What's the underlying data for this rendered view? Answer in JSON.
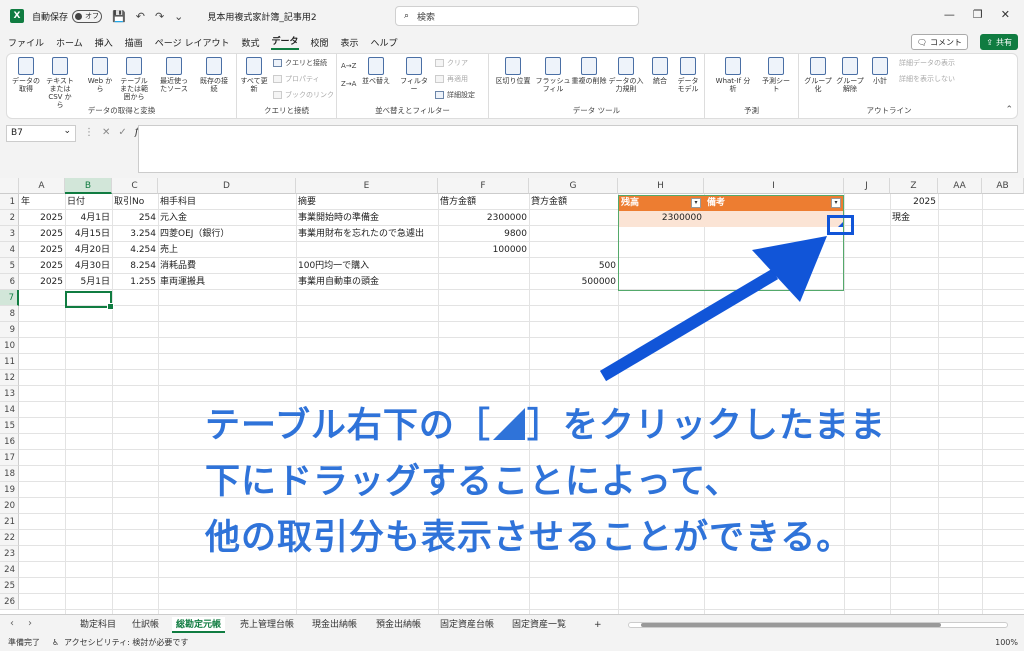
{
  "titlebar": {
    "autosave_label": "自動保存",
    "autosave_state": "オフ",
    "doc_title": "見本用複式家計簿_記事用2",
    "search_placeholder": "検索"
  },
  "menu": [
    "ファイル",
    "ホーム",
    "挿入",
    "描画",
    "ページ レイアウト",
    "数式",
    "データ",
    "校閲",
    "表示",
    "ヘルプ"
  ],
  "menu_active": "データ",
  "comment_label": "コメント",
  "share_label": "共有",
  "ribbon": {
    "groups": {
      "get_data": "データの取得と変換",
      "queries": "クエリと接続",
      "sort_filter": "並べ替えとフィルター",
      "data_tools": "データ ツール",
      "forecast": "予測",
      "outline": "アウトライン"
    },
    "buttons": {
      "get_data": "データの取得",
      "text_csv": "テキストまたは CSV から",
      "web": "Web から",
      "table_range": "テーブルまたは範囲から",
      "recent_sources": "最近使ったソース",
      "existing_conn": "既存の接続",
      "refresh_all": "すべて更新",
      "queries_conn": "クエリと接続",
      "properties": "プロパティ",
      "edit_links": "ブックのリンク",
      "sort_az": "A→Z",
      "sort_za": "Z→A",
      "sort": "並べ替え",
      "filter": "フィルター",
      "clear": "クリア",
      "reapply": "再適用",
      "advanced": "詳細設定",
      "text_columns": "区切り位置",
      "flash_fill": "フラッシュ フィル",
      "remove_dup": "重複の削除",
      "data_validation": "データの入力規則",
      "consolidate": "統合",
      "data_model": "データ モデル",
      "whatif": "What-If 分析",
      "forecast_sheet": "予測シート",
      "group": "グループ化",
      "ungroup": "グループ解除",
      "subtotal": "小計",
      "show_detail": "詳細データの表示",
      "hide_detail": "詳細を表示しない"
    }
  },
  "namebox": "B7",
  "columns": [
    {
      "id": "A",
      "label": "A"
    },
    {
      "id": "B",
      "label": "B"
    },
    {
      "id": "C",
      "label": "C"
    },
    {
      "id": "D",
      "label": "D"
    },
    {
      "id": "E",
      "label": "E"
    },
    {
      "id": "F",
      "label": "F"
    },
    {
      "id": "G",
      "label": "G"
    },
    {
      "id": "H",
      "label": "H"
    },
    {
      "id": "I",
      "label": "I"
    },
    {
      "id": "J",
      "label": "J"
    },
    {
      "id": "Z",
      "label": "Z"
    },
    {
      "id": "AA",
      "label": "AA"
    },
    {
      "id": "AB",
      "label": "AB"
    }
  ],
  "row_numbers": [
    "1",
    "2",
    "3",
    "4",
    "5",
    "6",
    "7",
    "8",
    "9",
    "10",
    "11",
    "12",
    "13",
    "14",
    "15",
    "16",
    "17",
    "18",
    "19",
    "20",
    "21",
    "22",
    "23",
    "24",
    "25",
    "26"
  ],
  "header_row": {
    "A": "年",
    "B": "日付",
    "C": "取引No",
    "D": "相手科目",
    "E": "摘要",
    "F": "借方金額",
    "G": "貸方金額",
    "H": "残高",
    "I": "備考",
    "Z": "2025"
  },
  "rows": [
    {
      "A": "2025",
      "B": "4月1日",
      "C": "254",
      "D": "元入金",
      "E": "事業開始時の準備金",
      "F": "2300000",
      "G": "",
      "H": "2300000",
      "Z": "現金"
    },
    {
      "A": "2025",
      "B": "4月15日",
      "C": "3.254",
      "D": "四菱OEJ（銀行）",
      "E": "事業用財布を忘れたので急遽出",
      "F": "9800",
      "G": "",
      "H": "",
      "Z": ""
    },
    {
      "A": "2025",
      "B": "4月20日",
      "C": "4.254",
      "D": "売上",
      "E": "",
      "F": "100000",
      "G": "",
      "H": "",
      "Z": ""
    },
    {
      "A": "2025",
      "B": "4月30日",
      "C": "8.254",
      "D": "消耗品費",
      "E": "100円均一で購入",
      "F": "",
      "G": "500",
      "H": "",
      "Z": ""
    },
    {
      "A": "2025",
      "B": "5月1日",
      "C": "1.255",
      "D": "車両運搬具",
      "E": "事業用自動車の頭金",
      "F": "",
      "G": "500000",
      "H": "",
      "Z": ""
    }
  ],
  "annotation": {
    "line1_a": "テーブル右下の［",
    "line1_b": "］をクリックしたまま",
    "line2": "下にドラッグすることによって、",
    "line3": "他の取引分も表示させることができる。"
  },
  "sheets": [
    "勘定科目",
    "仕訳帳",
    "総勘定元帳",
    "売上管理台帳",
    "現金出納帳",
    "預金出納帳",
    "固定資産台帳",
    "固定資産一覧"
  ],
  "sheet_active": "総勘定元帳",
  "status": {
    "ready": "準備完了",
    "accessibility": "アクセシビリティ: 検討が必要です",
    "zoom": "100%"
  },
  "colors": {
    "excel_green": "#107c41",
    "table_header": "#ed7d31",
    "annotation_blue": "#2f73d9"
  }
}
